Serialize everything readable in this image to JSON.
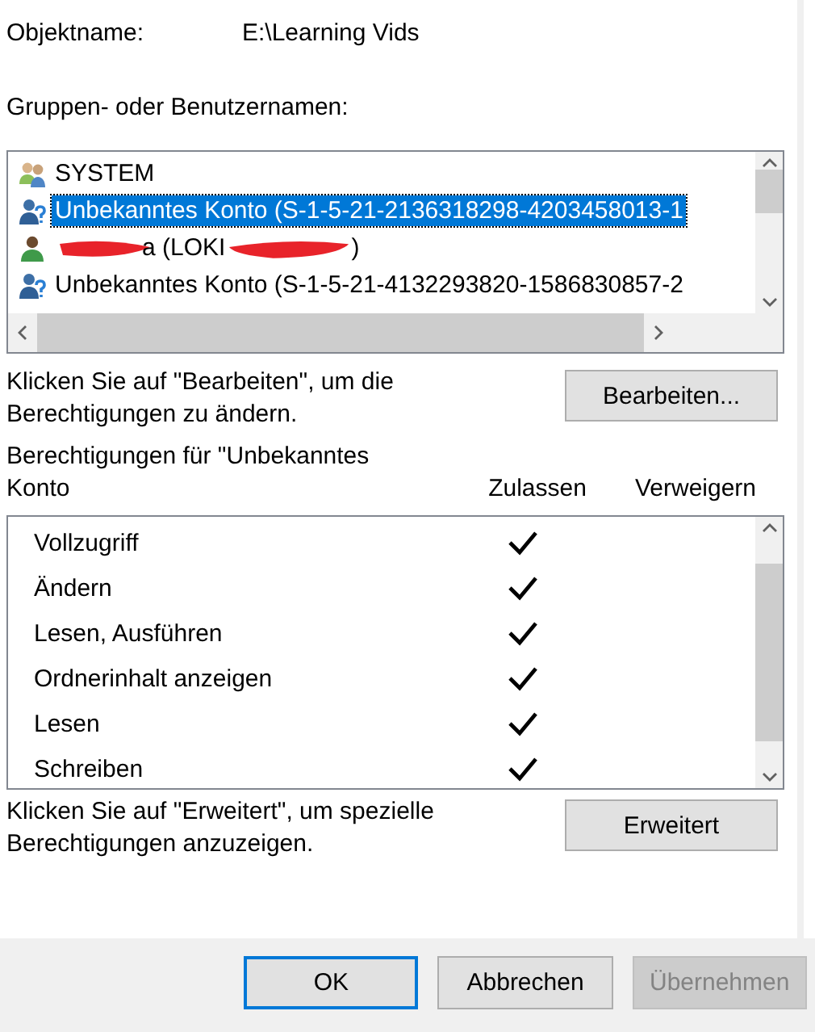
{
  "object": {
    "label": "Objektname:",
    "value": "E:\\Learning Vids"
  },
  "groups": {
    "label": "Gruppen- oder Benutzernamen:",
    "items": [
      {
        "kind": "group",
        "text": "SYSTEM",
        "selected": false
      },
      {
        "kind": "unknown",
        "text": "Unbekanntes Konto (S-1-5-21-2136318298-4203458013-1",
        "selected": true
      },
      {
        "kind": "redacted",
        "text": "a (LOKI",
        "text_after": ")",
        "selected": false
      },
      {
        "kind": "unknown",
        "text": "Unbekanntes Konto (S-1-5-21-4132293820-1586830857-2",
        "selected": false
      }
    ]
  },
  "edit_hint": "Klicken Sie auf \"Bearbeiten\", um die Berechtigungen zu ändern.",
  "edit_button": "Bearbeiten...",
  "permissions": {
    "title": "Berechtigungen für \"Unbekanntes Konto",
    "columns": [
      "Zulassen",
      "Verweigern"
    ],
    "rows": [
      {
        "name": "Vollzugriff",
        "allow": true,
        "deny": false
      },
      {
        "name": "Ändern",
        "allow": true,
        "deny": false
      },
      {
        "name": "Lesen, Ausführen",
        "allow": true,
        "deny": false
      },
      {
        "name": "Ordnerinhalt anzeigen",
        "allow": true,
        "deny": false
      },
      {
        "name": "Lesen",
        "allow": true,
        "deny": false
      },
      {
        "name": "Schreiben",
        "allow": true,
        "deny": false
      }
    ]
  },
  "advanced_hint": "Klicken Sie auf \"Erweitert\", um spezielle Berechtigungen anzuzeigen.",
  "advanced_button": "Erweitert",
  "buttons": [
    {
      "label": "OK",
      "kind": "default",
      "disabled": false
    },
    {
      "label": "Abbrechen",
      "kind": "normal",
      "disabled": false
    },
    {
      "label": "Übernehmen",
      "kind": "normal",
      "disabled": true
    }
  ]
}
